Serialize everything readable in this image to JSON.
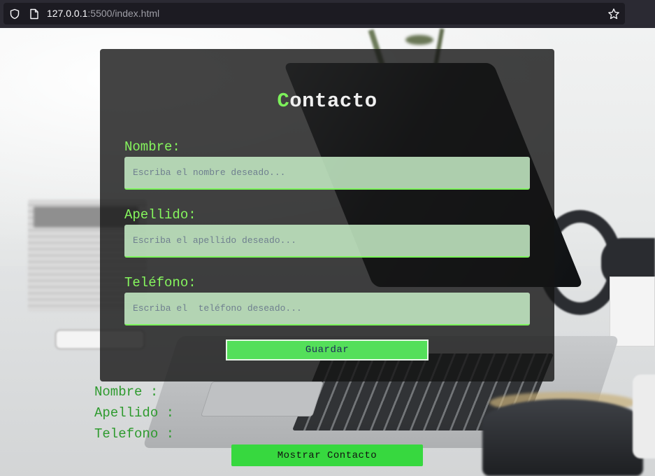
{
  "browser": {
    "url_host": "127.0.0.1",
    "url_rest": ":5500/index.html"
  },
  "form": {
    "title_first_letter": "C",
    "title_rest": "ontacto",
    "fields": [
      {
        "label": "Nombre:",
        "placeholder": "Escriba el nombre deseado...",
        "value": ""
      },
      {
        "label": "Apellido:",
        "placeholder": "Escriba el apellido deseado...",
        "value": ""
      },
      {
        "label": "Teléfono:",
        "placeholder": "Escriba el  teléfono deseado...",
        "value": ""
      }
    ],
    "save_label": "Guardar"
  },
  "results": {
    "lines": [
      "Nombre :",
      "Apellido :",
      "Telefono :"
    ],
    "show_label": "Mostrar Contacto"
  },
  "colors": {
    "accent_green": "#86f75e",
    "button_green": "#37d83f",
    "result_text": "#2e9a2e"
  },
  "icons": {
    "toolbar": [
      "shield-icon",
      "page-icon",
      "star-icon"
    ]
  }
}
